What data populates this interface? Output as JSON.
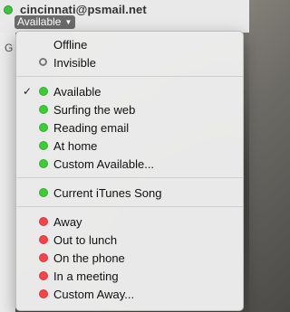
{
  "account": {
    "email": "cincinnati@psmail.net",
    "status": "Available"
  },
  "menu": {
    "groups": [
      [
        {
          "label": "Offline",
          "indicator": "none",
          "checked": false
        },
        {
          "label": "Invisible",
          "indicator": "hollow",
          "checked": false
        }
      ],
      [
        {
          "label": "Available",
          "indicator": "green",
          "checked": true
        },
        {
          "label": "Surfing the web",
          "indicator": "green",
          "checked": false
        },
        {
          "label": "Reading email",
          "indicator": "green",
          "checked": false
        },
        {
          "label": "At home",
          "indicator": "green",
          "checked": false
        },
        {
          "label": "Custom Available...",
          "indicator": "green",
          "checked": false
        }
      ],
      [
        {
          "label": "Current iTunes Song",
          "indicator": "green",
          "checked": false
        }
      ],
      [
        {
          "label": "Away",
          "indicator": "red",
          "checked": false
        },
        {
          "label": "Out to lunch",
          "indicator": "red",
          "checked": false
        },
        {
          "label": "On the phone",
          "indicator": "red",
          "checked": false
        },
        {
          "label": "In a meeting",
          "indicator": "red",
          "checked": false
        },
        {
          "label": "Custom Away...",
          "indicator": "red",
          "checked": false
        }
      ]
    ],
    "check_glyph": "✓"
  },
  "colors": {
    "available": "#3fc93b",
    "away": "#f2444c",
    "invisible_ring": "#7a7a7a"
  }
}
